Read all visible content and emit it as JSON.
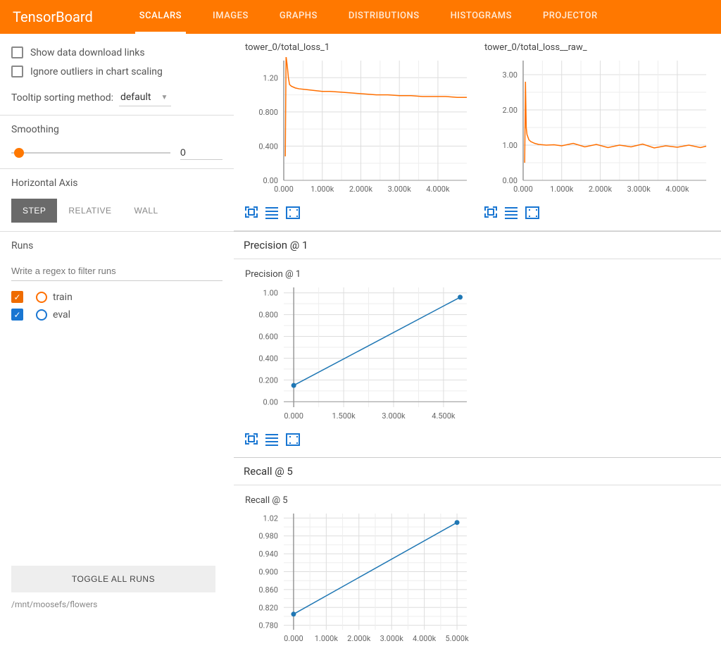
{
  "brand": "TensorBoard",
  "tabs": [
    "SCALARS",
    "IMAGES",
    "GRAPHS",
    "DISTRIBUTIONS",
    "HISTOGRAMS",
    "PROJECTOR"
  ],
  "activeTab": 0,
  "sidebar": {
    "showDownload": "Show data download links",
    "ignoreOutliers": "Ignore outliers in chart scaling",
    "tooltipLabel": "Tooltip sorting method:",
    "tooltipValue": "default",
    "smoothingLabel": "Smoothing",
    "smoothingValue": "0",
    "axisLabel": "Horizontal Axis",
    "axisOptions": [
      "STEP",
      "RELATIVE",
      "WALL"
    ],
    "runsLabel": "Runs",
    "runsFilterPlaceholder": "Write a regex to filter runs",
    "runs": [
      {
        "name": "train",
        "color": "orange",
        "checked": true,
        "sq": "#ef6c00"
      },
      {
        "name": "eval",
        "color": "blue",
        "checked": true,
        "sq": "#1976d2"
      }
    ],
    "toggleAll": "TOGGLE ALL RUNS",
    "path": "/mnt/moosefs/flowers"
  },
  "groups": [
    {
      "title": "Precision @ 1",
      "chartTitle": "Precision @ 1"
    },
    {
      "title": "Recall @ 5",
      "chartTitle": "Recall @ 5"
    }
  ],
  "topCharts": [
    "tower_0/total_loss_1",
    "tower_0/total_loss__raw_"
  ],
  "chart_data": [
    {
      "type": "line",
      "title": "tower_0/total_loss_1",
      "xlabel": "",
      "ylabel": "",
      "xlim": [
        0,
        4750
      ],
      "ylim": [
        0,
        1.4
      ],
      "xticks": [
        0,
        1000,
        2000,
        3000,
        4000
      ],
      "xtick_labels": [
        "0.000",
        "1.000k",
        "2.000k",
        "3.000k",
        "4.000k"
      ],
      "yticks": [
        0.0,
        0.4,
        0.8,
        1.2
      ],
      "series": [
        {
          "name": "train",
          "color": "#ff6f00",
          "x": [
            40,
            60,
            80,
            100,
            120,
            150,
            200,
            300,
            400,
            600,
            800,
            1000,
            1200,
            1500,
            1800,
            2100,
            2400,
            2700,
            3000,
            3300,
            3600,
            3900,
            4200,
            4500,
            4750
          ],
          "y": [
            0.28,
            1.45,
            1.38,
            1.3,
            1.2,
            1.12,
            1.1,
            1.08,
            1.07,
            1.06,
            1.05,
            1.04,
            1.04,
            1.03,
            1.02,
            1.01,
            1.0,
            1.0,
            0.99,
            0.99,
            0.98,
            0.98,
            0.98,
            0.97,
            0.97
          ]
        }
      ]
    },
    {
      "type": "line",
      "title": "tower_0/total_loss__raw_",
      "xlabel": "",
      "ylabel": "",
      "xlim": [
        0,
        4750
      ],
      "ylim": [
        0,
        3.4
      ],
      "xticks": [
        0,
        1000,
        2000,
        3000,
        4000
      ],
      "xtick_labels": [
        "0.000",
        "1.000k",
        "2.000k",
        "3.000k",
        "4.000k"
      ],
      "yticks": [
        0.0,
        1.0,
        2.0,
        3.0
      ],
      "series": [
        {
          "name": "train",
          "color": "#ff6f00",
          "x": [
            40,
            60,
            80,
            100,
            150,
            200,
            300,
            400,
            600,
            800,
            1000,
            1300,
            1600,
            1900,
            2200,
            2500,
            2800,
            3100,
            3400,
            3700,
            4000,
            4300,
            4600,
            4750
          ],
          "y": [
            0.5,
            2.8,
            1.5,
            1.3,
            1.15,
            1.1,
            1.05,
            1.02,
            1.0,
            1.01,
            0.98,
            1.05,
            0.95,
            1.02,
            0.93,
            1.0,
            0.95,
            1.03,
            0.92,
            0.98,
            0.94,
            1.0,
            0.93,
            0.97
          ]
        }
      ]
    },
    {
      "type": "line",
      "title": "Precision @ 1",
      "xlabel": "",
      "ylabel": "",
      "xlim": [
        -300,
        5200
      ],
      "ylim": [
        -0.05,
        1.05
      ],
      "xticks": [
        0,
        1500,
        3000,
        4500
      ],
      "xtick_labels": [
        "0.000",
        "1.500k",
        "3.000k",
        "4.500k"
      ],
      "yticks": [
        0.0,
        0.2,
        0.4,
        0.6,
        0.8,
        1.0
      ],
      "series": [
        {
          "name": "eval",
          "color": "#1f77b4",
          "x": [
            0,
            5000
          ],
          "y": [
            0.15,
            0.96
          ],
          "markers": true
        }
      ]
    },
    {
      "type": "line",
      "title": "Recall @ 5",
      "xlabel": "",
      "ylabel": "",
      "xlim": [
        -300,
        5300
      ],
      "ylim": [
        0.77,
        1.03
      ],
      "xticks": [
        0,
        1000,
        2000,
        3000,
        4000,
        5000
      ],
      "xtick_labels": [
        "0.000",
        "1.000k",
        "2.000k",
        "3.000k",
        "4.000k",
        "5.000k"
      ],
      "yticks": [
        0.78,
        0.82,
        0.86,
        0.9,
        0.94,
        0.98,
        1.02
      ],
      "series": [
        {
          "name": "eval",
          "color": "#1f77b4",
          "x": [
            0,
            5000
          ],
          "y": [
            0.805,
            1.01
          ],
          "markers": true
        }
      ]
    }
  ]
}
